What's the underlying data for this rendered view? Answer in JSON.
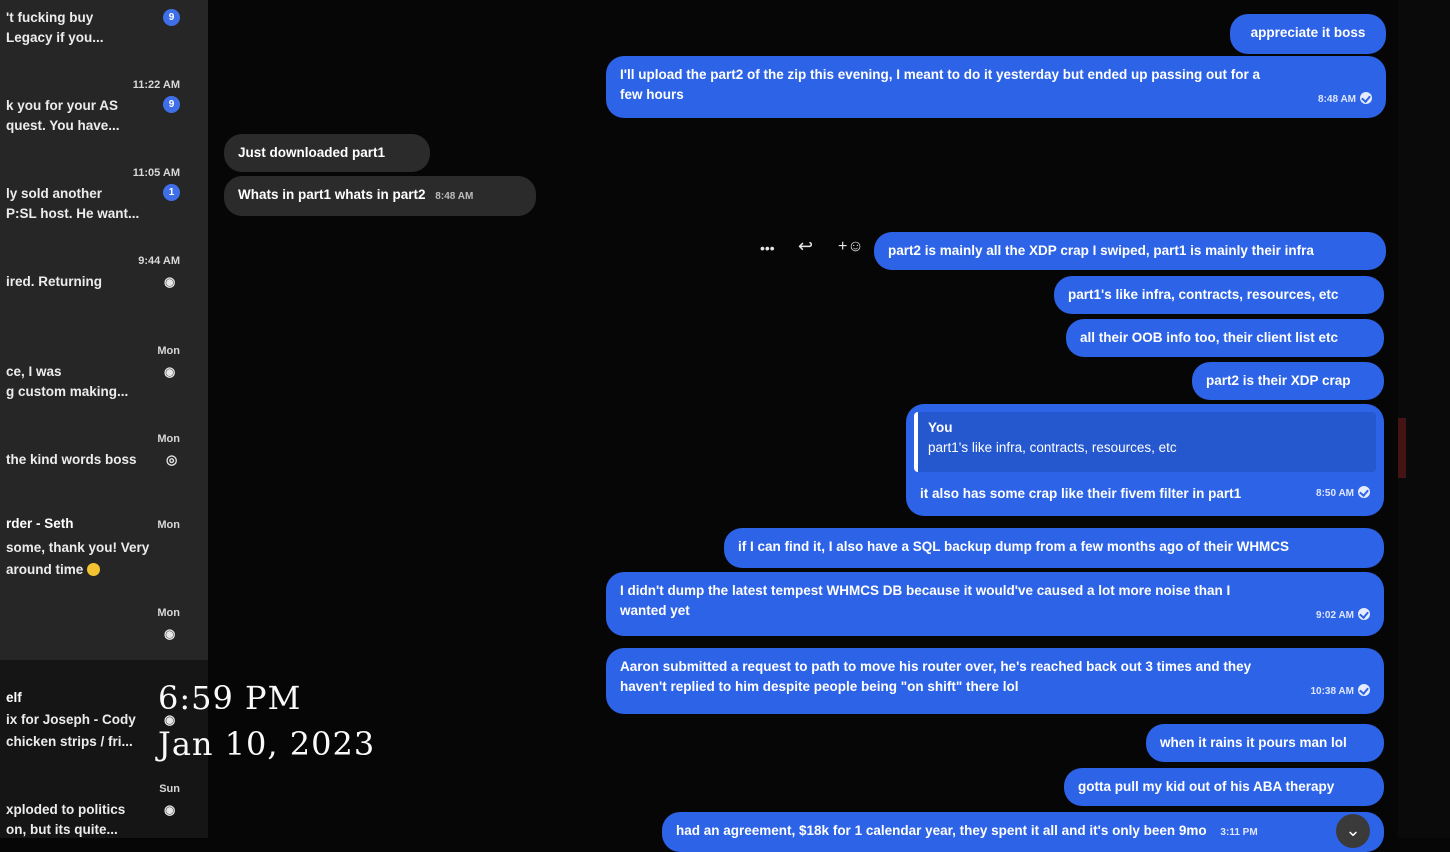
{
  "sidebar": {
    "conversations": [
      {
        "line1": "'t fucking buy",
        "line2": "Legacy if you...",
        "time": "",
        "badge": "9",
        "status": "badge"
      },
      {
        "line1": "k you for your AS",
        "line2": "quest. You have...",
        "time": "11:22 AM",
        "badge": "9",
        "status": "badge"
      },
      {
        "line1": "ly sold another",
        "line2": "P:SL host. He want...",
        "time": "11:05 AM",
        "badge": "1",
        "status": "badge"
      },
      {
        "line1": "ired. Returning",
        "line2": "",
        "time": "9:44 AM",
        "badge": "",
        "status": "seen"
      },
      {
        "line1": "ce, I was",
        "line2": "g custom making...",
        "time": "Mon",
        "badge": "",
        "status": "seen"
      },
      {
        "line1": "the kind words boss",
        "line2": "",
        "time": "Mon",
        "badge": "",
        "status": "seen"
      },
      {
        "line1": "rder - Seth",
        "line2": "some, thank you! Very",
        "line3": "around time",
        "time": "Mon",
        "badge": "",
        "status": "none"
      },
      {
        "line1": "",
        "line2": "",
        "time": "Mon",
        "badge": "",
        "status": "seen"
      },
      {
        "line1": "elf",
        "line2": "ix for Joseph - Cody",
        "line3": "chicken strips / fri...",
        "time": "",
        "badge": "",
        "status": "seen"
      },
      {
        "line1": "xploded to politics",
        "line2": "on, but its quite...",
        "time": "Sun",
        "badge": "",
        "status": "seen"
      }
    ]
  },
  "overlay": {
    "time": "6:59 PM",
    "date": "Jan 10, 2023"
  },
  "chat": {
    "m1": {
      "text": "appreciate it boss"
    },
    "m2": {
      "line1": "I'll upload the part2 of the zip this evening, I meant to do it yesterday but ended up passing out for a",
      "line2": "few hours",
      "time": "8:48 AM"
    },
    "in1": {
      "text": "Just downloaded part1"
    },
    "in2": {
      "text": "Whats in part1 whats in part2",
      "time": "8:48 AM"
    },
    "m3": {
      "text": "part2 is mainly all the XDP crap I swiped, part1 is mainly their infra"
    },
    "m4": {
      "text": "part1's like infra, contracts, resources, etc"
    },
    "m5": {
      "text": "all their OOB info too, their client list etc"
    },
    "m6": {
      "text": "part2 is their XDP crap"
    },
    "m7": {
      "quote_author": "You",
      "quote_text": "part1's like infra, contracts, resources, etc",
      "text": "it also has some crap like their fivem filter in part1",
      "time": "8:50 AM"
    },
    "m8": {
      "text": "if I can find it, I also have a SQL backup dump from a few months ago of their WHMCS"
    },
    "m9": {
      "line1": "I didn't dump the latest tempest WHMCS DB because it would've caused a lot more noise than I",
      "line2": "wanted yet",
      "time": "9:02 AM"
    },
    "m10": {
      "line1": "Aaron submitted a request to path to move his router over, he's reached back out 3 times and they",
      "line2": "haven't replied to him despite people being \"on shift\" there lol",
      "time": "10:38 AM"
    },
    "m11": {
      "text": "when it rains it pours man lol"
    },
    "m12": {
      "text": "gotta pull my kid out of his ABA therapy"
    },
    "m13": {
      "text": "had an agreement, $18k for 1 calendar year, they spent it all and it's only been 9mo",
      "time": "3:11 PM"
    }
  },
  "actions": {
    "more": "•••",
    "reply": "↩",
    "react": "+☺"
  },
  "scroll_down_icon": "⌄",
  "colors": {
    "outgoing": "#2d63e6",
    "incoming": "#2b2b2b",
    "sidebar": "#262626",
    "badge": "#3f6fe8"
  }
}
